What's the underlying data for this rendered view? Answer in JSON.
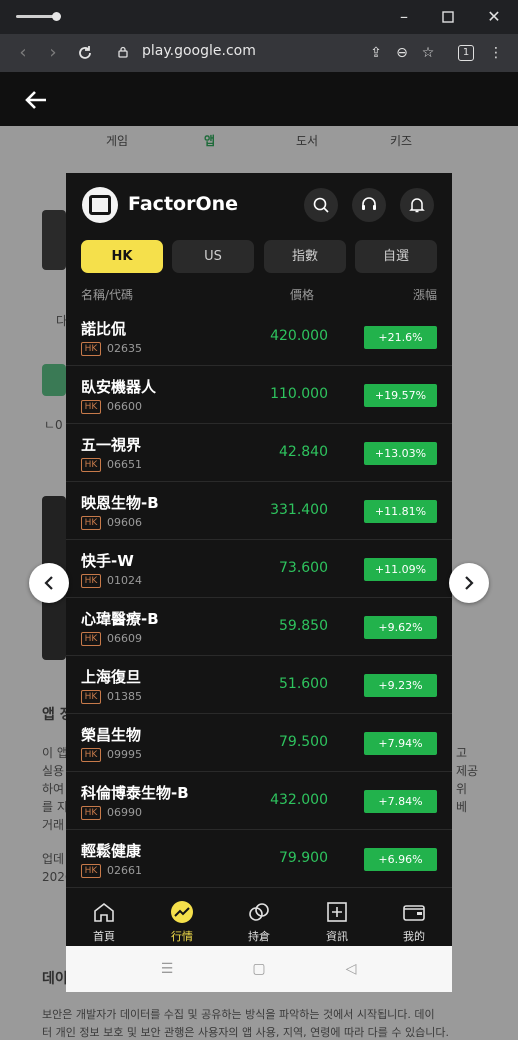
{
  "browser": {
    "url": "play.google.com",
    "tab_count": "1"
  },
  "store": {
    "categories": [
      "게임",
      "앱",
      "도서",
      "키즈"
    ],
    "selected_category": "앱",
    "ghost_texts": {
      "app_info_heading": "앱 정",
      "desc_lines": [
        "이 앱",
        "실용",
        "하여",
        "를 지",
        "거래"
      ],
      "updated_label": "업데",
      "updated_value": "2026",
      "data_heading": "데이",
      "data_text_1": "보안은 개발자가 데이터를 수집 및 공유하는 방식을 파악하는 것에서 시작됩니다. 데이",
      "data_text_2": "터 개인 정보 보호 및 보안 관행은 사용자의 앱 사용, 지역, 연령에 따라 다를 수 있습니다.",
      "right_fragments": [
        "고",
        "제공",
        "위",
        "베"
      ],
      "side_small": "다",
      "side_small_2": "ㄴ0"
    }
  },
  "app": {
    "name": "FactorOne",
    "market_tabs": [
      "HK",
      "US",
      "指數",
      "自選"
    ],
    "active_tab": "HK",
    "columns": {
      "name": "名稱/代碼",
      "price": "價格",
      "change": "漲幅"
    },
    "market_badge": "HK",
    "stocks": [
      {
        "name": "諾比侃",
        "code": "02635",
        "price": "420.000",
        "change": "+21.6%"
      },
      {
        "name": "臥安機器人",
        "code": "06600",
        "price": "110.000",
        "change": "+19.57%"
      },
      {
        "name": "五一視界",
        "code": "06651",
        "price": "42.840",
        "change": "+13.03%"
      },
      {
        "name": "映恩生物-B",
        "code": "09606",
        "price": "331.400",
        "change": "+11.81%"
      },
      {
        "name": "快手-W",
        "code": "01024",
        "price": "73.600",
        "change": "+11.09%"
      },
      {
        "name": "心瑋醫療-B",
        "code": "06609",
        "price": "59.850",
        "change": "+9.62%"
      },
      {
        "name": "上海復旦",
        "code": "01385",
        "price": "51.600",
        "change": "+9.23%"
      },
      {
        "name": "榮昌生物",
        "code": "09995",
        "price": "79.500",
        "change": "+7.94%"
      },
      {
        "name": "科倫博泰生物-B",
        "code": "06990",
        "price": "432.000",
        "change": "+7.84%"
      },
      {
        "name": "輕鬆健康",
        "code": "02661",
        "price": "79.900",
        "change": "+6.96%"
      }
    ],
    "bottom_nav": [
      {
        "label": "首頁",
        "icon": "home-icon"
      },
      {
        "label": "行情",
        "icon": "market-trend-icon"
      },
      {
        "label": "持倉",
        "icon": "holdings-icon"
      },
      {
        "label": "資訊",
        "icon": "news-icon"
      },
      {
        "label": "我的",
        "icon": "wallet-icon"
      }
    ],
    "active_nav": "行情"
  },
  "colors": {
    "accent_yellow": "#f5e04b",
    "up_green": "#22b24c",
    "price_green": "#2ec35e",
    "hk_badge": "#c77a4a"
  }
}
